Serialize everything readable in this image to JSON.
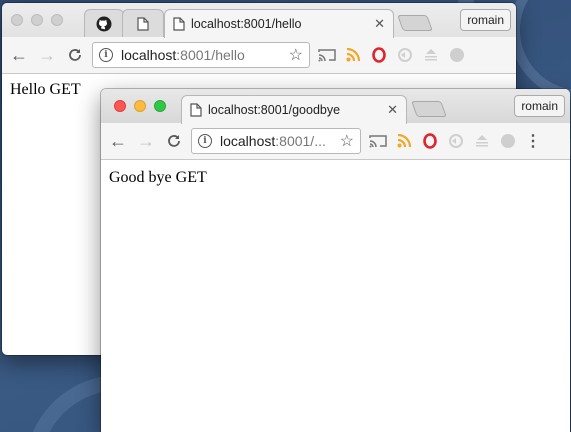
{
  "back_window": {
    "tabs": [
      {
        "icon": "github-icon",
        "title": ""
      },
      {
        "icon": "page-icon",
        "title": ""
      },
      {
        "icon": "page-icon",
        "title": "localhost:8001/hello"
      }
    ],
    "profile_label": "romain",
    "address": {
      "host": "localhost",
      "rest": ":8001/hello"
    },
    "body_text": "Hello GET"
  },
  "front_window": {
    "tab": {
      "icon": "page-icon",
      "title": "localhost:8001/goodbye"
    },
    "profile_label": "romain",
    "address": {
      "host": "localhost",
      "rest": ":8001/..."
    },
    "body_text": "Good bye GET"
  },
  "extensions": [
    "cast-icon",
    "rss-icon",
    "opera-icon",
    "sync-icon",
    "download-icon",
    "circle-icon"
  ],
  "colors": {
    "rss": "#f5a623",
    "opera": "#e0242b",
    "traffic_red": "#fc5753",
    "traffic_yellow": "#fdbc40",
    "traffic_green": "#33c748"
  }
}
